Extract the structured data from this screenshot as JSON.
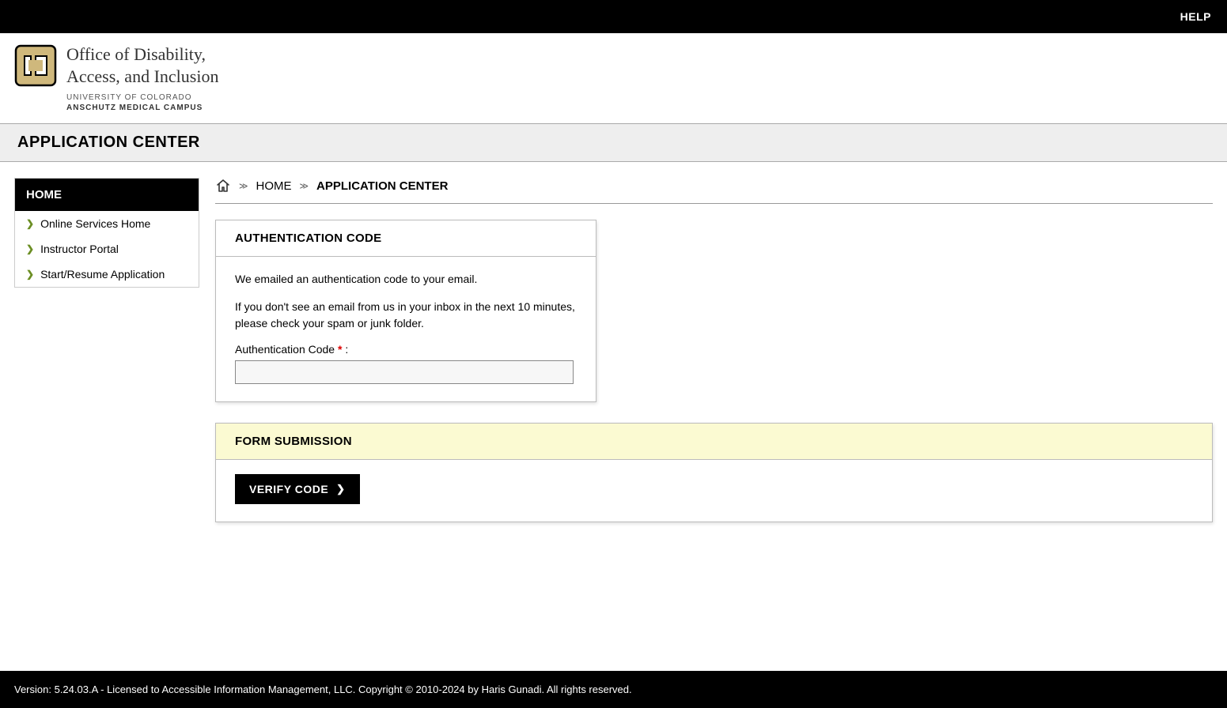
{
  "topbar": {
    "help_label": "HELP"
  },
  "logo": {
    "line1": "Office of Disability,",
    "line2": "Access, and Inclusion",
    "sub1": "UNIVERSITY OF COLORADO",
    "sub2": "ANSCHUTZ MEDICAL CAMPUS"
  },
  "page_title": "APPLICATION CENTER",
  "sidebar": {
    "heading": "HOME",
    "items": [
      {
        "label": "Online Services Home"
      },
      {
        "label": "Instructor Portal"
      },
      {
        "label": "Start/Resume Application"
      }
    ]
  },
  "breadcrumb": {
    "home": "HOME",
    "current": "APPLICATION CENTER"
  },
  "auth_panel": {
    "heading": "AUTHENTICATION CODE",
    "msg1": "We emailed an authentication code to your email.",
    "msg2": "If you don't see an email from us in your inbox in the next 10 minutes, please check your spam or junk folder.",
    "field_label": "Authentication Code",
    "field_suffix": ":",
    "value": ""
  },
  "form_panel": {
    "heading": "FORM SUBMISSION",
    "button_label": "VERIFY CODE"
  },
  "footer": {
    "text": "Version: 5.24.03.A - Licensed to Accessible Information Management, LLC. Copyright © 2010-2024 by Haris Gunadi. All rights reserved."
  }
}
